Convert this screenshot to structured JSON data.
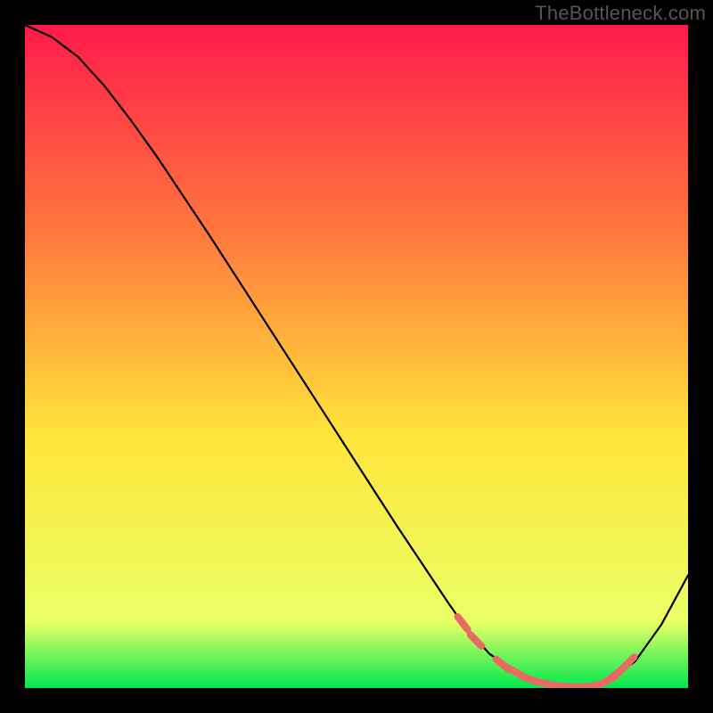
{
  "watermark": "TheBottleneck.com",
  "chart_data": {
    "type": "line",
    "title": "",
    "xlabel": "",
    "ylabel": "",
    "xlim": [
      0,
      100
    ],
    "ylim": [
      0,
      100
    ],
    "grid": false,
    "background_gradient": {
      "top_color": "#ff1a4b",
      "mid_color": "#ffe53b",
      "bottom_color": "#00e84f"
    },
    "series": [
      {
        "name": "curve",
        "color": "#000000",
        "x": [
          0,
          4,
          8,
          12,
          16,
          20,
          24,
          28,
          32,
          36,
          40,
          44,
          48,
          52,
          56,
          60,
          64,
          66,
          70,
          74,
          78,
          82,
          86,
          88,
          92,
          96,
          100
        ],
        "y": [
          100,
          98.2,
          95.2,
          90.8,
          85.6,
          80.0,
          74.0,
          68.0,
          61.8,
          55.6,
          49.4,
          43.2,
          37.0,
          30.8,
          24.6,
          18.6,
          12.6,
          9.8,
          5.2,
          2.4,
          0.8,
          0.2,
          0.4,
          1.2,
          4.0,
          9.6,
          17.0
        ]
      }
    ],
    "markers": {
      "name": "valley-dashes",
      "color": "#e86a62",
      "shape": "rounded-dash",
      "points": [
        {
          "x": 66,
          "y": 9.8
        },
        {
          "x": 68,
          "y": 7.2
        },
        {
          "x": 72,
          "y": 3.6
        },
        {
          "x": 74,
          "y": 2.4
        },
        {
          "x": 76,
          "y": 1.4
        },
        {
          "x": 78,
          "y": 0.8
        },
        {
          "x": 80,
          "y": 0.4
        },
        {
          "x": 82,
          "y": 0.2
        },
        {
          "x": 84,
          "y": 0.2
        },
        {
          "x": 86,
          "y": 0.4
        },
        {
          "x": 88,
          "y": 1.2
        },
        {
          "x": 89,
          "y": 2.0
        },
        {
          "x": 90,
          "y": 2.8
        },
        {
          "x": 91,
          "y": 3.8
        }
      ]
    }
  }
}
